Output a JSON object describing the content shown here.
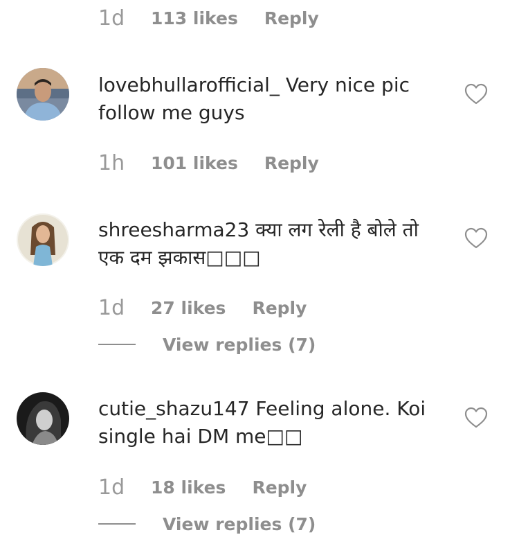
{
  "top_meta": {
    "time": "1d",
    "likes": "113 likes",
    "reply": "Reply"
  },
  "comments": [
    {
      "username": "lovebhullarofficial_",
      "text": "Very nice pic follow me guys",
      "time": "1h",
      "likes": "101 likes",
      "reply": "Reply",
      "avatar_icon": "avatar-photo-man"
    },
    {
      "username": "shreesharma23",
      "text": "क्या लग रेली है बोले तो एक दम झकास□□□",
      "time": "1d",
      "likes": "27 likes",
      "reply": "Reply",
      "view_replies": "View replies (7)",
      "avatar_icon": "avatar-photo-woman"
    },
    {
      "username": "cutie_shazu147",
      "text": "Feeling alone. Koi single hai DM me□□",
      "time": "1d",
      "likes": "18 likes",
      "reply": "Reply",
      "view_replies": "View replies (7)",
      "avatar_icon": "avatar-photo-bw"
    }
  ],
  "icons": {
    "like": "heart-outline-icon"
  },
  "colors": {
    "text": "#262626",
    "secondary": "#8e8e8e",
    "background": "#ffffff"
  }
}
